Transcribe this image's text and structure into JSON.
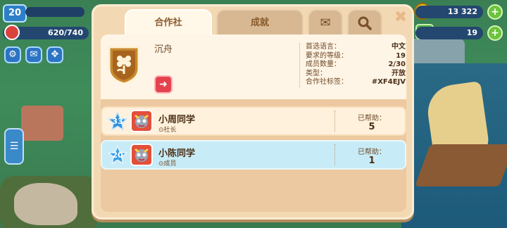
{
  "hud": {
    "level": "20",
    "population": "620/740",
    "coins": "13 322",
    "cash": "19",
    "plus": "+"
  },
  "tabs": [
    {
      "label": "合作社",
      "active": true
    },
    {
      "label": "成就",
      "active": false
    },
    {
      "icon": "mail-icon"
    },
    {
      "icon": "search-icon"
    }
  ],
  "club": {
    "name": "沉舟",
    "info": [
      {
        "k": "首选语言：",
        "v": "中文"
      },
      {
        "k": "要求的等级：",
        "v": "19"
      },
      {
        "k": "成员数量：",
        "v": "2/30"
      },
      {
        "k": "类型：",
        "v": "开放"
      },
      {
        "k": "合作社标签：",
        "v": "#XF4EJV"
      }
    ]
  },
  "members": [
    {
      "level": "33",
      "name": "小周同学",
      "role": "⊙社长",
      "helped_label": "已帮助：",
      "helped": "5",
      "star_color": "#2b8fe0"
    },
    {
      "level": "20",
      "name": "小陈同学",
      "role": "⊙成员",
      "helped_label": "已帮助：",
      "helped": "1",
      "star_color": "#3aa0e8"
    }
  ],
  "colors": {
    "accent_red": "#e4434d",
    "panel": "#f3d9b3",
    "highlight_row": "#c8ecf7"
  }
}
